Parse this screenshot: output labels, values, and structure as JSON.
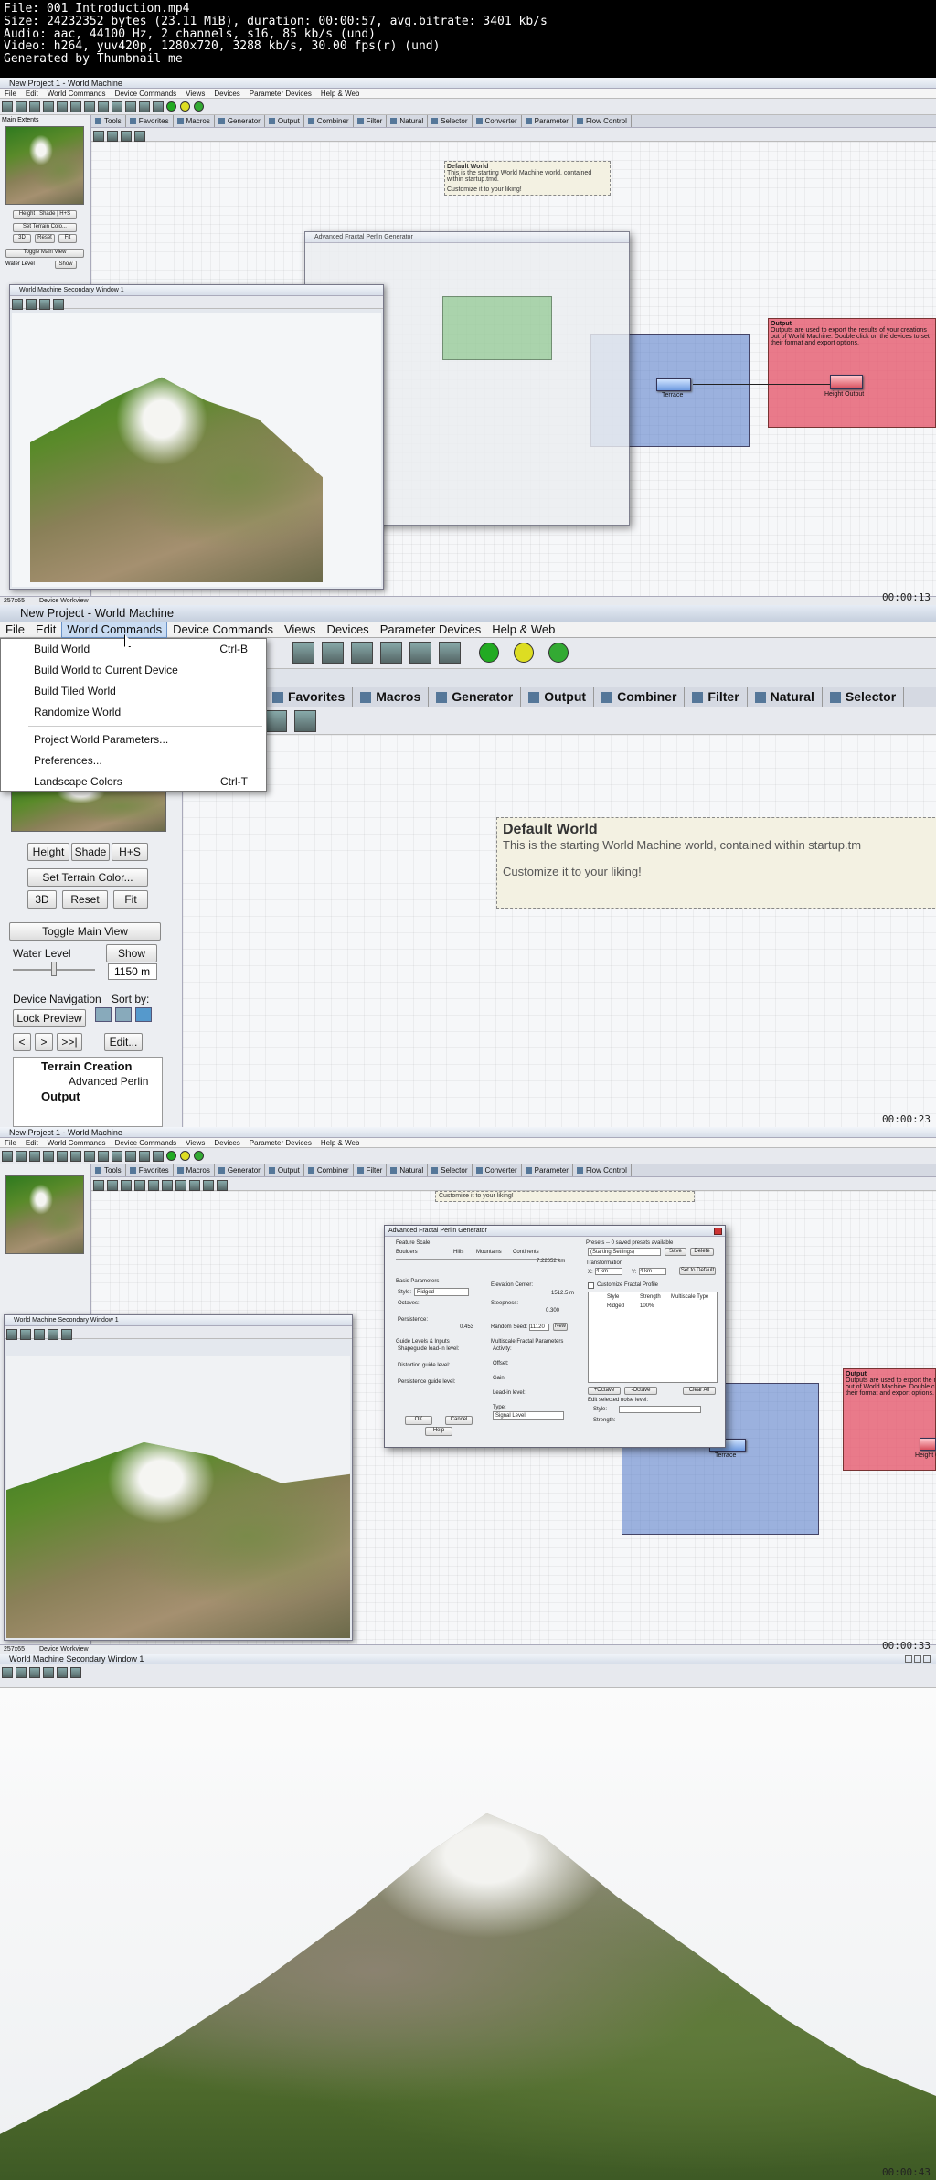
{
  "header": {
    "lines": [
      "File: 001 Introduction.mp4",
      "Size: 24232352 bytes (23.11 MiB), duration: 00:00:57, avg.bitrate: 3401 kb/s",
      "Audio: aac, 44100 Hz, 2 channels, s16, 85 kb/s (und)",
      "Video: h264, yuv420p, 1280x720, 3288 kb/s, 30.00 fps(r) (und)",
      "Generated by Thumbnail me"
    ]
  },
  "frame1": {
    "timestamp": "00:00:13",
    "window_title": "New Project 1 - World Machine",
    "menu": [
      "File",
      "Edit",
      "World Commands",
      "Device Commands",
      "Views",
      "Devices",
      "Parameter Devices",
      "Help & Web"
    ],
    "tabs": [
      "Tools",
      "Favorites",
      "Macros",
      "Generator",
      "Output",
      "Combiner",
      "Filter",
      "Natural",
      "Selector",
      "Converter",
      "Parameter",
      "Flow Control"
    ],
    "sidebar": {
      "main_extents": "Main Extents",
      "height_shade": "Height | Shade | H+S",
      "set_terrain": "Set Terrain Colo...",
      "d3": "3D",
      "reset": "Reset",
      "fit": "Fit",
      "toggle": "Toggle Main View",
      "water": "Water Level",
      "show": "Show"
    },
    "note": {
      "title": "Default World",
      "line1": "This is the starting World Machine world, contained within startup.tmd.",
      "line2": "Customize it to your liking!"
    },
    "dialog_title": "Advanced Fractal Perlin Generator",
    "subwindow_title": "World Machine Secondary Window 1",
    "terrace_label": "Terrace",
    "output": {
      "title": "Output",
      "text": "Outputs are used to export the results of your creations out of World Machine. Double click on the devices to set their format and export options.",
      "device": "Height Output"
    },
    "status": {
      "size": "257x65",
      "label": "Device Workview"
    }
  },
  "frame2": {
    "timestamp": "00:00:23",
    "window_title": "New Project - World Machine",
    "menu": [
      "File",
      "Edit",
      "World Commands",
      "Device Commands",
      "Views",
      "Devices",
      "Parameter Devices",
      "Help & Web"
    ],
    "dropdown": [
      {
        "label": "Build World",
        "shortcut": "Ctrl-B"
      },
      {
        "label": "Build World to Current Device",
        "shortcut": ""
      },
      {
        "label": "Build Tiled World",
        "shortcut": ""
      },
      {
        "label": "Randomize World",
        "shortcut": ""
      },
      {
        "label": "Project World Parameters...",
        "shortcut": ""
      },
      {
        "label": "Preferences...",
        "shortcut": ""
      },
      {
        "label": "Landscape Colors",
        "shortcut": "Ctrl-T"
      }
    ],
    "tabs": [
      "Favorites",
      "Macros",
      "Generator",
      "Output",
      "Combiner",
      "Filter",
      "Natural",
      "Selector"
    ],
    "sidebar": {
      "height": "Height",
      "shade": "Shade",
      "hs": "H+S",
      "set_terrain": "Set Terrain Color...",
      "d3": "3D",
      "reset": "Reset",
      "fit": "Fit",
      "toggle": "Toggle Main View",
      "water": "Water Level",
      "show": "Show",
      "water_value": "1150 m",
      "device_nav": "Device Navigation",
      "sort_by": "Sort by:",
      "lock": "Lock Preview",
      "prev": "<",
      "next": ">",
      "last": ">>|",
      "edit": "Edit...",
      "tree_root": "Terrain Creation",
      "tree_child": "Advanced Perlin",
      "tree_next": "Output"
    },
    "note": {
      "title": "Default World",
      "line1": "This is the starting World Machine world, contained within startup.tm",
      "line2": "Customize it to your liking!"
    }
  },
  "frame3": {
    "timestamp": "00:00:33",
    "window_title": "New Project 1 - World Machine",
    "menu": [
      "File",
      "Edit",
      "World Commands",
      "Device Commands",
      "Views",
      "Devices",
      "Parameter Devices",
      "Help & Web"
    ],
    "tabs": [
      "Tools",
      "Favorites",
      "Macros",
      "Generator",
      "Output",
      "Combiner",
      "Filter",
      "Natural",
      "Selector",
      "Converter",
      "Parameter",
      "Flow Control"
    ],
    "note_line": "Customize it to your liking!",
    "dialog": {
      "title": "Advanced Fractal Perlin Generator",
      "feature_scale": "Feature Scale",
      "boulders": "Boulders",
      "hills": "Hills",
      "mountains": "Mountains",
      "continents": "Continents",
      "scale_value": "7.22652 km",
      "basis": "Basis Parameters",
      "style_label": "Style:",
      "style_value": "Ridged",
      "elevation": "Elevation Center:",
      "elevation_value": "1512.5 m",
      "octaves": "Octaves:",
      "steepness": "Steepness:",
      "steepness_value": "0.300",
      "persistence": "Persistence:",
      "persistence_value": "0.453",
      "seed": "Random Seed:",
      "seed_value": "11120",
      "new": "New",
      "guide": "Guide Levels & Inputs",
      "shape_guide": "Shapeguide load-in level:",
      "distort": "Distortion guide level:",
      "persist_guide": "Persistence guide level:",
      "multiscale": "Multiscale Fractal Parameters",
      "activity": "Activity:",
      "offset": "Offset:",
      "gain": "Gain:",
      "lead_in": "Lead-in level:",
      "type": "Type:",
      "type_value": "Signal Level",
      "ok": "OK",
      "cancel": "Cancel",
      "help": "Help",
      "presets": "Presets -- 0 saved presets available",
      "starting": "(Starting Settings)",
      "save": "Save",
      "delete": "Delete",
      "transformation": "Transformation",
      "x": "X:",
      "y": "Y:",
      "x_value": "4 km",
      "y_value": "4 km",
      "set_default": "Set to Default",
      "customize": "Customize Fractal Profile",
      "col_style": "Style",
      "col_strength": "Strength",
      "col_mtype": "Multiscale Type",
      "row_style": "Ridged",
      "row_strength": "100%",
      "add": "+Octave",
      "remove": "-Octave",
      "clear": "Clear All",
      "edit_noise": "Edit selected noise level:",
      "style2": "Style:",
      "strength": "Strength:"
    },
    "subwindow_title": "World Machine Secondary Window 1",
    "terrace_label": "Terrace",
    "output": {
      "title": "Output",
      "text": "Outputs are used to export the results of your creations out of World Machine. Double click on the devices to set their format and export options.",
      "device": "Height Output"
    },
    "status": {
      "size": "257x65",
      "label": "Device Workview"
    }
  },
  "frame4": {
    "timestamp": "00:00:43",
    "window_title": "World Machine Secondary Window 1"
  }
}
